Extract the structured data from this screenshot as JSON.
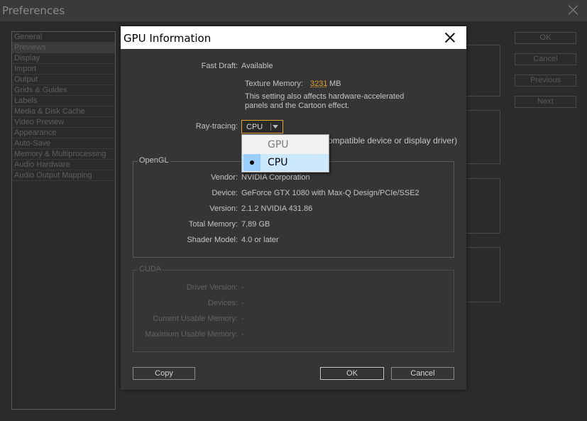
{
  "preferences": {
    "title": "Preferences",
    "categories": [
      "General",
      "Previews",
      "Display",
      "Import",
      "Output",
      "Grids & Guides",
      "Labels",
      "Media & Disk Cache",
      "Video Preview",
      "Appearance",
      "Auto-Save",
      "Memory & Multiprocessing",
      "Audio Hardware",
      "Audio Output Mapping"
    ],
    "selected_category": "Previews",
    "buttons": {
      "ok": "OK",
      "cancel": "Cancel",
      "previous": "Previous",
      "next": "Next"
    }
  },
  "dialog": {
    "title": "GPU Information",
    "fast_draft_label": "Fast Draft:",
    "fast_draft_value": "Available",
    "texture_memory_label": "Texture Memory:",
    "texture_memory_value": "3231",
    "texture_memory_unit": "MB",
    "note_line1": "This setting also affects hardware-accelerated",
    "note_line2": "panels and the Cartoon effect.",
    "ray_tracing_label": "Ray-tracing:",
    "ray_tracing_value": "CPU",
    "ray_tracing_note": "ompatible device or display driver)",
    "ray_tracing_options": [
      "GPU",
      "CPU"
    ],
    "opengl": {
      "title": "OpenGL",
      "rows": [
        {
          "label": "Vendor:",
          "value": "NVIDIA Corporation"
        },
        {
          "label": "Device:",
          "value": "GeForce GTX 1080 with Max-Q Design/PCIe/SSE2"
        },
        {
          "label": "Version:",
          "value": "2.1.2 NVIDIA 431.86"
        },
        {
          "label": "Total Memory:",
          "value": "7,89 GB"
        },
        {
          "label": "Shader Model:",
          "value": "4.0 or later"
        }
      ]
    },
    "cuda": {
      "title": "CUDA",
      "rows": [
        {
          "label": "Driver Version:",
          "value": "-"
        },
        {
          "label": "Devices:",
          "value": "-"
        },
        {
          "label": "Current Usable Memory:",
          "value": "-"
        },
        {
          "label": "Maximum Usable Memory:",
          "value": "-"
        }
      ]
    },
    "buttons": {
      "copy": "Copy",
      "ok": "OK",
      "cancel": "Cancel"
    }
  }
}
